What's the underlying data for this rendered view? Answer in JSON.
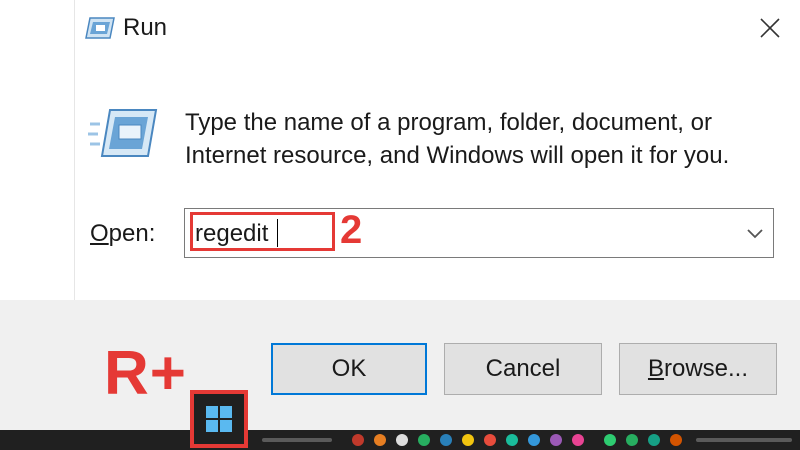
{
  "window": {
    "title": "Run",
    "title_icon": "run-icon",
    "close_icon": "close-icon"
  },
  "main": {
    "big_icon": "run-icon",
    "description": "Type the name of a program, folder, document, or Internet resource, and Windows will open it for you.",
    "open_label_underlined": "O",
    "open_label_rest": "pen:",
    "open_value": "regedit",
    "dropdown_icon": "chevron-down-icon"
  },
  "buttons": {
    "ok_label": "OK",
    "cancel_label": "Cancel",
    "browse_underlined": "B",
    "browse_rest": "rowse..."
  },
  "annotations": {
    "step_number": "2",
    "keyboard_hint": "R+",
    "color": "#e53935"
  },
  "taskbar": {
    "start_icon": "windows-logo-icon",
    "accent": "#0078d7",
    "background": "#202020"
  }
}
